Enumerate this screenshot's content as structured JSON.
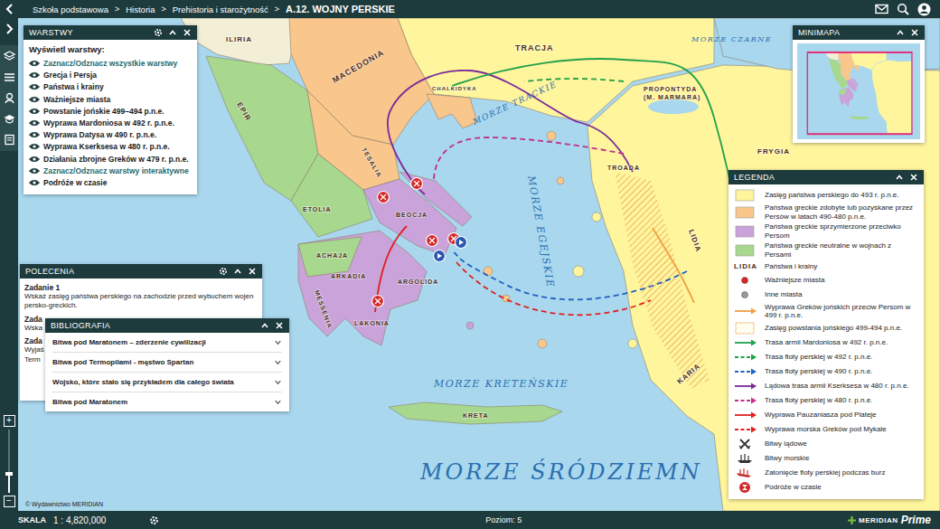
{
  "topbar": {
    "breadcrumb": [
      {
        "label": "Szkoła podstawowa"
      },
      {
        "label": "Historia"
      },
      {
        "label": "Prehistoria i starożytność"
      },
      {
        "label": "A.12. WOJNY PERSKIE"
      }
    ],
    "separator": ">"
  },
  "layers_panel": {
    "title": "WARSTWY",
    "heading": "Wyświetl warstwy:",
    "items": [
      {
        "label": "Zaznacz/Odznacz wszystkie warstwy",
        "kind": "link",
        "visible": true
      },
      {
        "label": "Grecja i Persja",
        "kind": "layer",
        "visible": true
      },
      {
        "label": "Państwa i krainy",
        "kind": "layer",
        "visible": true
      },
      {
        "label": "Ważniejsze miasta",
        "kind": "layer",
        "visible": true
      },
      {
        "label": "Powstanie jońskie 499–494 p.n.e.",
        "kind": "layer",
        "visible": true
      },
      {
        "label": "Wyprawa Mardoniosa w 492 r. p.n.e.",
        "kind": "layer",
        "visible": true
      },
      {
        "label": "Wyprawa Datysa w 490 r. p.n.e.",
        "kind": "layer",
        "visible": true
      },
      {
        "label": "Wyprawa Kserksesa w 480 r. p.n.e.",
        "kind": "layer",
        "visible": true
      },
      {
        "label": "Działania zbrojne Greków w 479 r. p.n.e.",
        "kind": "layer",
        "visible": true
      },
      {
        "label": "Zaznacz/Odznacz warstwy interaktywne",
        "kind": "link",
        "visible": true
      },
      {
        "label": "Podróże w czasie",
        "kind": "layer",
        "visible": true
      }
    ]
  },
  "tasks_panel": {
    "title": "POLECENIA",
    "tasks": [
      {
        "title": "Zadanie 1",
        "lines": [
          "Wskaż zasięg państwa perskiego na zachodzie przed wybuchem wojen persko-greckich."
        ]
      },
      {
        "title": "Zada",
        "lines": [
          "Wska"
        ]
      },
      {
        "title": "Zada",
        "lines": [
          "Wyjaś",
          "Term"
        ]
      }
    ]
  },
  "bibliography_panel": {
    "title": "BIBLIOGRAFIA",
    "items": [
      {
        "label": "Bitwa pod Maratonem – zderzenie cywilizacji",
        "expanded": false
      },
      {
        "label": "Bitwa pod Termopilami - męstwo Spartan",
        "expanded": false
      },
      {
        "label": "Wojsko, które stało się przykładem dla całego świata",
        "expanded": false
      },
      {
        "label": "Bitwa pod Maratonem",
        "expanded": false
      }
    ]
  },
  "minimap": {
    "title": "MINIMAPA"
  },
  "legend": {
    "title": "LEGENDA",
    "items": [
      {
        "kind": "swatch",
        "color": "#fff59d",
        "label": "Zasięg państwa perskiego do 493 r. p.n.e."
      },
      {
        "kind": "swatch",
        "color": "#f9c68c",
        "label": "Państwa greckie zdobyte lub pozyskane przez Persów w latach 490-480 p.n.e."
      },
      {
        "kind": "swatch",
        "color": "#c9a3d9",
        "label": "Państwa greckie sprzymierzone przeciwko Persom"
      },
      {
        "kind": "swatch",
        "color": "#a8d88e",
        "label": "Państwa greckie neutralne w wojnach z Persami"
      },
      {
        "kind": "label-sample",
        "sample": "LIDIA",
        "label": "Państwa i krainy"
      },
      {
        "kind": "dot",
        "color": "#e02020",
        "label": "Ważniejsze miasta"
      },
      {
        "kind": "dot",
        "color": "#999999",
        "label": "Inne miasta"
      },
      {
        "kind": "line",
        "color": "#f0a040",
        "label": "Wyprawa Greków jońskich przeciw Persom w 499 r. p.n.e."
      },
      {
        "kind": "hatch",
        "color": "#e8a050",
        "label": "Zasięg powstania jońskiego 499-494 p.n.e."
      },
      {
        "kind": "line",
        "color": "#22a04a",
        "label": "Trasa armii Mardoniosa w 492 r. p.n.e."
      },
      {
        "kind": "dashed-line",
        "color": "#22a04a",
        "label": "Trasa floty perskiej w 492 r. p.n.e."
      },
      {
        "kind": "dashed-line",
        "color": "#2060c0",
        "label": "Trasa floty perskiej w 490 r. p.n.e."
      },
      {
        "kind": "line",
        "color": "#7b2a9a",
        "label": "Lądowa trasa armii Kserksesa w 480 r. p.n.e."
      },
      {
        "kind": "dashed-line",
        "color": "#c0308a",
        "label": "Trasa floty perskiej w 480 r. p.n.e."
      },
      {
        "kind": "line",
        "color": "#e02020",
        "label": "Wyprawa Pauzaniasza pod Plateje"
      },
      {
        "kind": "dashed-line",
        "color": "#e02020",
        "label": "Wyprawa morska Greków pod Mykale"
      },
      {
        "kind": "land-battle",
        "label": "Bitwy lądowe"
      },
      {
        "kind": "sea-battle",
        "label": "Bitwy morskie"
      },
      {
        "kind": "sinking",
        "label": "Zatonięcie floty perskiej podczas burz"
      },
      {
        "kind": "travel",
        "label": "Podróże w czasie"
      }
    ]
  },
  "map": {
    "labels": [
      {
        "text": "ILIRIA",
        "kind": "region"
      },
      {
        "text": "TRACJA",
        "kind": "region"
      },
      {
        "text": "MORZE CZARNE",
        "kind": "sea"
      },
      {
        "text": "MACEDONIA",
        "kind": "region"
      },
      {
        "text": "PROPONTYDA",
        "kind": "region"
      },
      {
        "text": "(M. MARMARA)",
        "kind": "region"
      },
      {
        "text": "FRYGIA",
        "kind": "region"
      },
      {
        "text": "MORZE TRACKIE",
        "kind": "sea"
      },
      {
        "text": "MORZE EGEJSKIE",
        "kind": "sea"
      },
      {
        "text": "TROADA",
        "kind": "region"
      },
      {
        "text": "LIDIA",
        "kind": "region"
      },
      {
        "text": "KARIA",
        "kind": "region"
      },
      {
        "text": "EPIR",
        "kind": "region"
      },
      {
        "text": "TESALIA",
        "kind": "region"
      },
      {
        "text": "ETOLIA",
        "kind": "region"
      },
      {
        "text": "BEOCJA",
        "kind": "region"
      },
      {
        "text": "ACHAJA",
        "kind": "region"
      },
      {
        "text": "ARKADIA",
        "kind": "region"
      },
      {
        "text": "ARGOLIDA",
        "kind": "region"
      },
      {
        "text": "MESSENIA",
        "kind": "region"
      },
      {
        "text": "LAKONIA",
        "kind": "region"
      },
      {
        "text": "CHALKIDYKA",
        "kind": "region"
      },
      {
        "text": "MORZE KRETEŃSKIE",
        "kind": "sea"
      },
      {
        "text": "KRETA",
        "kind": "region"
      },
      {
        "text": "MORZE ŚRÓDZIEMN",
        "kind": "sea"
      }
    ],
    "copyright": "© Wydawnictwo MERIDIAN"
  },
  "zoom": {
    "plus": "+",
    "minus": "−",
    "level": 0.3
  },
  "bottombar": {
    "scale_label": "SKALA",
    "scale": "1 : 4,820,000",
    "level": "Poziom: 5",
    "logo": "MERIDIAN",
    "logo_suffix": "Prime"
  }
}
